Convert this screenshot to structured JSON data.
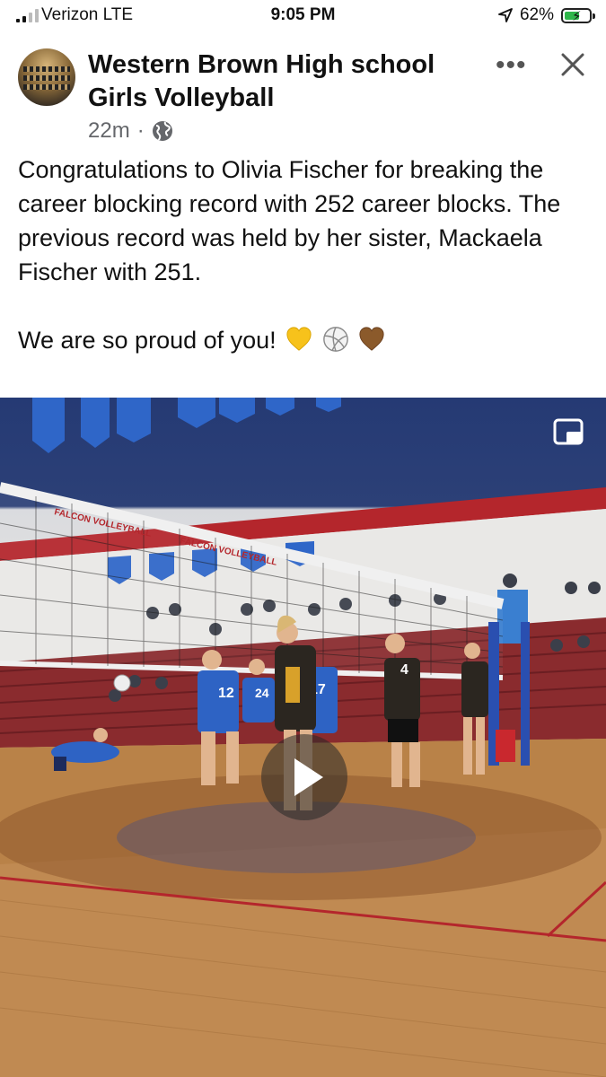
{
  "status_bar": {
    "carrier": "Verizon  LTE",
    "time": "9:05 PM",
    "battery": "62%",
    "battery_level": 0.62
  },
  "post": {
    "page_name": "Western Brown High school Girls Volleyball",
    "age": "22m",
    "separator": "·",
    "text_lines": [
      "Congratulations to Olivia Fischer for breaking the career blocking record with 252 career blocks. The previous record was held by her sister, Mackaela Fischer with 251."
    ],
    "closing_line": "We are so proud of you!",
    "emoji_icons": [
      "yellow-heart-icon",
      "volleyball-icon",
      "brown-heart-icon"
    ]
  },
  "video": {
    "banner_text": "FALCON VOLLEYBALL",
    "jersey_numbers": [
      "12",
      "24",
      "17",
      "4"
    ]
  },
  "colors": {
    "meta_text": "#65676b",
    "banner_blue": "#2c4077",
    "banner_red": "#b4262c"
  }
}
